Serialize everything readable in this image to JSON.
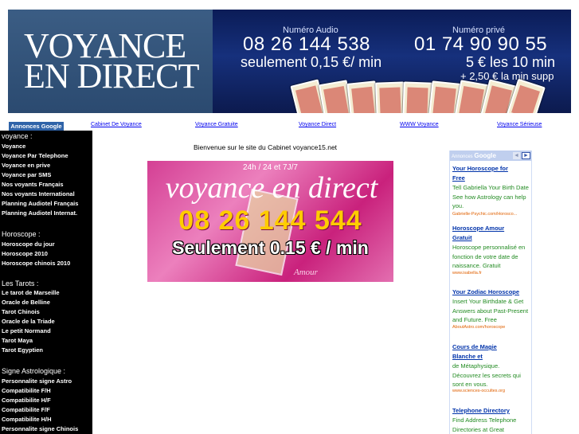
{
  "banner": {
    "brand_line1": "VOYANCE",
    "brand_line2": "EN DIRECT",
    "audio_label": "Numéro Audio",
    "audio_number": "08 26 144 538",
    "audio_price": "seulement 0,15 €/ min",
    "private_label": "Numéro privé",
    "private_number": "01 74 90 90 55",
    "private_price": "5 € les 10 min",
    "private_extra": "+ 2,50 € la min supp"
  },
  "ad_row": {
    "label": "Annonces Google",
    "links": [
      "Cabinet De Voyance",
      "Voyance Gratuite",
      "Voyance Direct",
      "WWW Voyance",
      "Voyance Sérieuse"
    ]
  },
  "sidebar": {
    "sections": [
      {
        "heading": "voyance :",
        "items": [
          "Voyance",
          "Voyance Par Telephone",
          "Voyance en prive",
          "Voyance par SMS",
          "Nos voyants Français",
          "Nos voyants International",
          "Planning Audiotel Français",
          "Planning Audiotel Internat."
        ]
      },
      {
        "heading": "Horoscope :",
        "items": [
          "Horoscope du jour",
          "Horoscope 2010",
          "Horoscope chinois 2010"
        ]
      },
      {
        "heading": "Les Tarots :",
        "items": [
          "Le tarot de Marseille",
          "Oracle de Belline",
          "Tarot Chinois",
          "Oracle de la Triade",
          "Le petit Normand",
          "Tarot Maya",
          "Tarot Egyptien"
        ]
      },
      {
        "heading": "Signe Astrologique :",
        "items": [
          "Personnalite signe Astro",
          "Compatibilite F/H",
          "Compatibilite H/F",
          "Compatibilite F/F",
          "Compatibilite H/H",
          "Personnalite signe Chinois"
        ]
      }
    ]
  },
  "main": {
    "welcome": "Bienvenue sur le site du Cabinet voyance15.net",
    "promo": {
      "hours": "24h / 24 et 7J/7",
      "title": "voyance en direct",
      "phone": "08 26 144 544",
      "price": "Seulement 0.15 € / min",
      "amour": "Amour"
    }
  },
  "ads": {
    "header_label": "Annonces",
    "header_brand": "Google",
    "prev": "◄",
    "next": "►",
    "items": [
      {
        "title_line1": "Your Horoscope for",
        "title_line2": "Free",
        "body": "Tell Gabriella Your Birth Date See how Astrology can help you.",
        "url": "Gabrielle-Psychic.com/Horosco..."
      },
      {
        "title_line1": "Horoscope Amour",
        "title_line2": "Gratuit",
        "body": "Horoscope personnalisé en fonction de votre date de naissance. Gratuit",
        "url": "www.isabella.fr"
      },
      {
        "title_line1": "Your Zodiac Horoscope",
        "title_line2": "",
        "body": "Insert Your Birthdate & Get Answers about Past-Present and Future. Free",
        "url": "AboutAstro.com/horoscope"
      },
      {
        "title_line1": "Cours de Magie",
        "title_line2": "Blanche et",
        "body": "de Métaphysique. Découvrez les secrets qui sont en vous.",
        "url": "www.sciences-occultes.org"
      },
      {
        "title_line1": "Telephone Directory",
        "title_line2": "",
        "body": "Find Address Telephone Directories at Great",
        "url": ""
      }
    ]
  },
  "colors": {
    "banner_bg": "#16307c",
    "ad_label_bg": "#2f63a8",
    "sidebar_bg": "#000000",
    "promo_bg": "#d43f94",
    "promo_phone": "#ffcc00",
    "ad_title": "#0033aa",
    "ad_body": "#228b22",
    "ad_url": "#e06000"
  }
}
